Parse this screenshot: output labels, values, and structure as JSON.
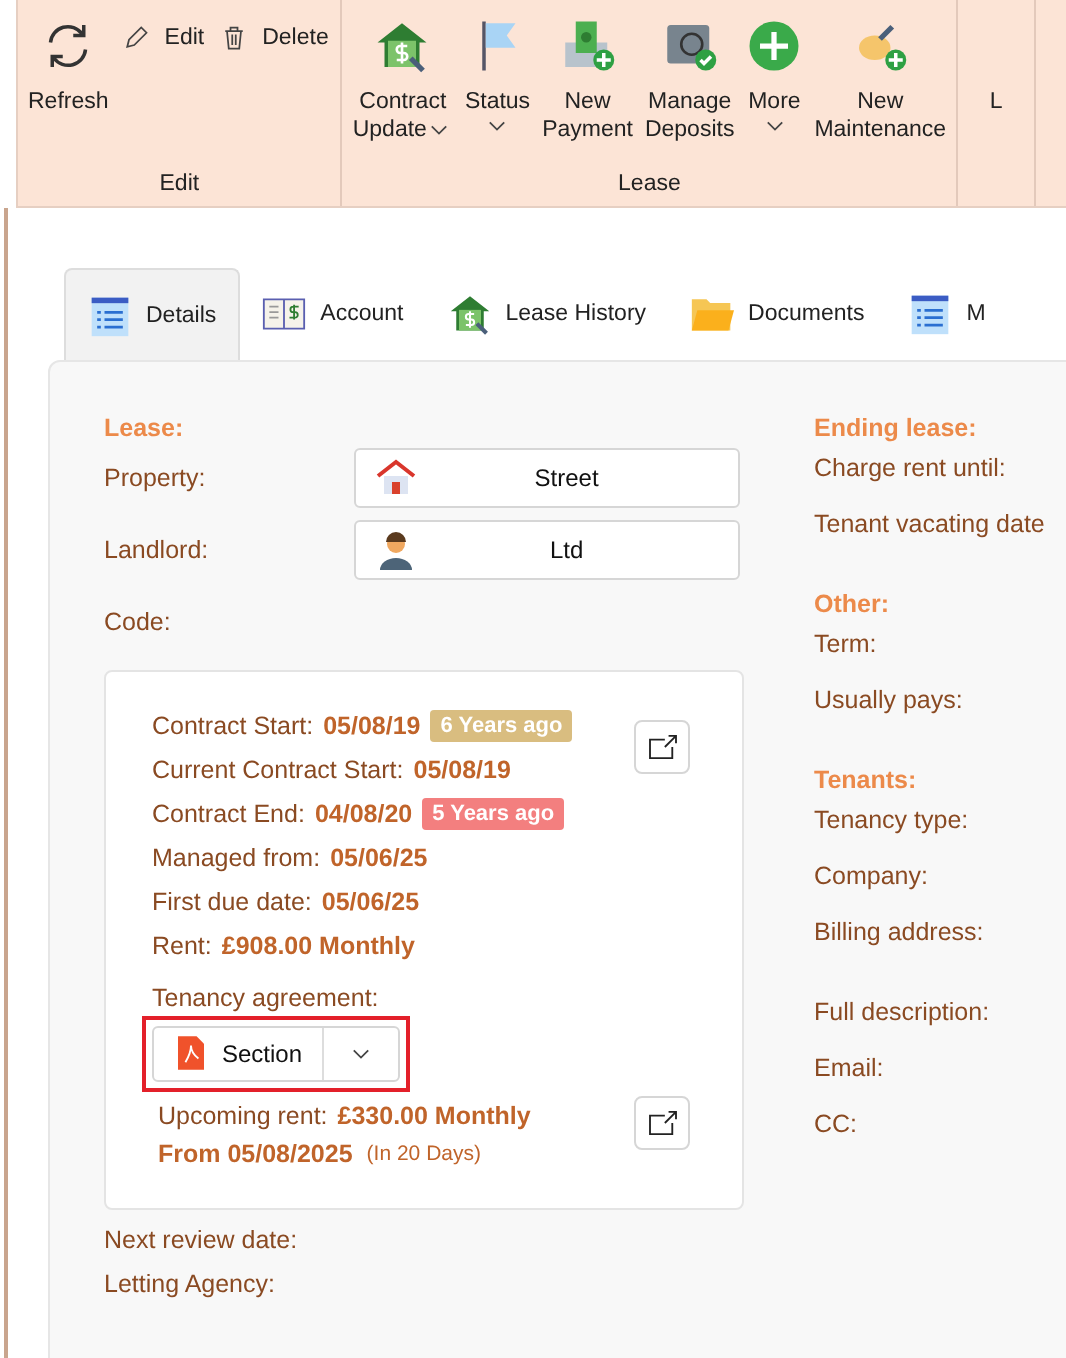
{
  "ribbon": {
    "groups": [
      {
        "label": "Edit",
        "buttons": [
          {
            "lines": [
              "Refresh"
            ],
            "kind": "large",
            "has_menu": false
          },
          {
            "lines": [
              "Edit"
            ],
            "kind": "small",
            "has_menu": false
          },
          {
            "lines": [
              "Delete"
            ],
            "kind": "small",
            "has_menu": false
          }
        ]
      },
      {
        "label": "Lease",
        "buttons": [
          {
            "lines": [
              "Contract",
              "Update"
            ],
            "kind": "large",
            "has_menu": true
          },
          {
            "lines": [
              "Status"
            ],
            "kind": "large",
            "has_menu": true
          },
          {
            "lines": [
              "New",
              "Payment"
            ],
            "kind": "large",
            "has_menu": false
          },
          {
            "lines": [
              "Manage",
              "Deposits"
            ],
            "kind": "large",
            "has_menu": false
          },
          {
            "lines": [
              "More"
            ],
            "kind": "large",
            "has_menu": true
          },
          {
            "lines": [
              "New",
              "Maintenance"
            ],
            "kind": "large",
            "has_menu": false
          }
        ]
      },
      {
        "buttons": [
          {
            "lines": [
              "L"
            ],
            "kind": "large",
            "has_menu": false
          }
        ]
      }
    ]
  },
  "tabs": [
    {
      "label": "Details",
      "selected": true
    },
    {
      "label": "Account",
      "selected": false
    },
    {
      "label": "Lease History",
      "selected": false
    },
    {
      "label": "Documents",
      "selected": false
    },
    {
      "label": "M",
      "selected": false
    }
  ],
  "lease": {
    "heading": "Lease:",
    "fields": [
      {
        "label": "Property:",
        "value": "Street"
      },
      {
        "label": "Landlord:",
        "value": "Ltd"
      },
      {
        "label": "Code:"
      }
    ]
  },
  "contract_card": {
    "rows": [
      {
        "label": "Contract Start:",
        "value": "05/08/19",
        "badge": "6 Years ago",
        "color": "#d9bd80"
      },
      {
        "label": "Current Contract Start:",
        "value": "05/08/19"
      },
      {
        "label": "Contract End:",
        "value": "04/08/20",
        "badge": "5 Years ago",
        "color": "#f37f7f"
      },
      {
        "label": "Managed from:",
        "value": "05/06/25"
      },
      {
        "label": "First due date:",
        "value": "05/06/25"
      },
      {
        "label": "Rent:",
        "value": "£908.00  Monthly"
      }
    ],
    "agreement_label": "Tenancy agreement:",
    "agreement_button": "Section",
    "highlighted": true,
    "upcoming_label": "Upcoming rent:",
    "upcoming_value": "£330.00 Monthly",
    "upcoming_from": "From 05/08/2025",
    "upcoming_note": "(In 20 Days)"
  },
  "after_card": [
    "Next review date:",
    "Letting Agency:"
  ],
  "right_sections": [
    {
      "heading": "Ending lease:",
      "labels": [
        "Charge rent until:",
        "Tenant vacating date"
      ]
    },
    {
      "heading": "Other:",
      "labels": [
        "Term:",
        "Usually pays:"
      ]
    },
    {
      "heading": "Tenants:",
      "labels": [
        "Tenancy type:",
        "Company:",
        "Billing address:"
      ]
    },
    {
      "labels": [
        "Full description:",
        "Email:",
        "CC:"
      ]
    }
  ]
}
